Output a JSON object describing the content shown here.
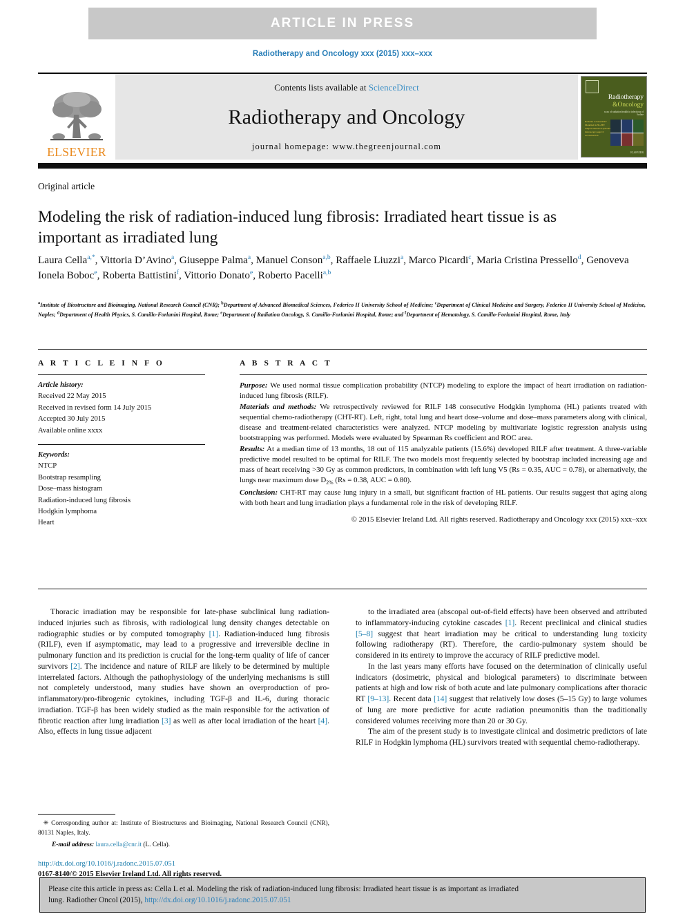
{
  "banner": {
    "text": "ARTICLE  IN  PRESS"
  },
  "running_head": "Radiotherapy and Oncology xxx (2015) xxx–xxx",
  "masthead": {
    "contents_prefix": "Contents lists available at ",
    "sciencedirect": "ScienceDirect",
    "journal_title": "Radiotherapy and Oncology",
    "homepage": "journal homepage: www.thegreenjournal.com",
    "publisher": "ELSEVIER",
    "cover": {
      "title_line1": "Radiotherapy",
      "title_line2": "&Oncology",
      "subtitle": "xxxx of radiation health in infectious of Isolate",
      "left_text": "Remarks to Issue RILF Modelled in HL-PET Subjects Research episodes microscopy page 10 reconstruction"
    }
  },
  "article_type": "Original article",
  "title": "Modeling the risk of radiation-induced lung fibrosis: Irradiated heart tissue is as important as irradiated lung",
  "authors": [
    {
      "name": "Laura Cella",
      "marks": "a,*"
    },
    {
      "name": "Vittoria D’Avino",
      "marks": "a"
    },
    {
      "name": "Giuseppe Palma",
      "marks": "a"
    },
    {
      "name": "Manuel Conson",
      "marks": "a,b"
    },
    {
      "name": "Raffaele Liuzzi",
      "marks": "a"
    },
    {
      "name": "Marco Picardi",
      "marks": "c"
    },
    {
      "name": "Maria Cristina Pressello",
      "marks": "d"
    },
    {
      "name": "Genoveva Ionela Boboc",
      "marks": "e"
    },
    {
      "name": "Roberta Battistini",
      "marks": "f"
    },
    {
      "name": "Vittorio Donato",
      "marks": "e"
    },
    {
      "name": "Roberto Pacelli",
      "marks": "a,b"
    }
  ],
  "affiliations": "Institute of Biostructure and Bioimaging, National Research Council (CNR); bDepartment of Advanced Biomedical Sciences, Federico II University School of Medicine; cDepartment of Clinical Medicine and Surgery, Federico II University School of Medicine, Naples; dDepartment of Health Physics, S. Camillo-Forlanini Hospital, Rome; eDepartment of Radiation Oncology, S. Camillo-Forlanini Hospital, Rome; and fDepartment of Hematology, S. Camillo-Forlanini Hospital, Rome, Italy",
  "article_info": {
    "heading": "A R T I C L E   I N F O",
    "history_label": "Article history:",
    "history": [
      "Received 22 May 2015",
      "Received in revised form 14 July 2015",
      "Accepted 30 July 2015",
      "Available online xxxx"
    ],
    "keywords_label": "Keywords:",
    "keywords": [
      "NTCP",
      "Bootstrap resampling",
      "Dose–mass histogram",
      "Radiation-induced lung fibrosis",
      "Hodgkin lymphoma",
      "Heart"
    ]
  },
  "abstract": {
    "heading": "A B S T R A C T",
    "purpose_label": "Purpose:",
    "purpose": " We used normal tissue complication probability (NTCP) modeling to explore the impact of heart irradiation on radiation-induced lung fibrosis (RILF).",
    "methods_label": "Materials and methods:",
    "methods": " We retrospectively reviewed for RILF 148 consecutive Hodgkin lymphoma (HL) patients treated with sequential chemo-radiotherapy (CHT-RT). Left, right, total lung and heart dose–volume and dose–mass parameters along with clinical, disease and treatment-related characteristics were analyzed. NTCP modeling by multivariate logistic regression analysis using bootstrapping was performed. Models were evaluated by Spearman Rs coefficient and ROC area.",
    "results_label": "Results:",
    "results": " At a median time of 13 months, 18 out of 115 analyzable patients (15.6%) developed RILF after treatment. A three-variable predictive model resulted to be optimal for RILF. The two models most frequently selected by bootstrap included increasing age and mass of heart receiving >30 Gy as common predictors, in combination with left lung V5 (Rs = 0.35, AUC = 0.78), or alternatively, the lungs near maximum dose D2% (Rs = 0.38, AUC = 0.80).",
    "conclusion_label": "Conclusion:",
    "conclusion": " CHT-RT may cause lung injury in a small, but significant fraction of HL patients. Our results suggest that aging along with both heart and lung irradiation plays a fundamental role in the risk of developing RILF.",
    "copyright": "© 2015 Elsevier Ireland Ltd. All rights reserved. Radiotherapy and Oncology xxx (2015) xxx–xxx"
  },
  "body": {
    "left_col": "Thoracic irradiation may be responsible for late-phase subclinical lung radiation-induced injuries such as fibrosis, with radiological lung density changes detectable on radiographic studies or by computed tomography [1]. Radiation-induced lung fibrosis (RILF), even if asymptomatic, may lead to a progressive and irreversible decline in pulmonary function and its prediction is crucial for the long-term quality of life of cancer survivors [2]. The incidence and nature of RILF are likely to be determined by multiple interrelated factors. Although the pathophysiology of the underlying mechanisms is still not completely understood, many studies have shown an overproduction of pro-inflammatory/pro-fibrogenic cytokines, including TGF-β and IL-6, during thoracic irradiation. TGF-β has been widely studied as the main responsible for the activation of fibrotic reaction after lung irradiation [3] as well as after local irradiation of the heart [4]. Also, effects in lung tissue adjacent",
    "right_col_p1": "to the irradiated area (abscopal out-of-field effects) have been observed and attributed to inflammatory-inducing cytokine cascades [1]. Recent preclinical and clinical studies [5–8] suggest that heart irradiation may be critical to understanding lung toxicity following radiotherapy (RT). Therefore, the cardio-pulmonary system should be considered in its entirety to improve the accuracy of RILF predictive model.",
    "right_col_p2": "In the last years many efforts have focused on the determination of clinically useful indicators (dosimetric, physical and biological parameters) to discriminate between patients at high and low risk of both acute and late pulmonary complications after thoracic RT [9–13]. Recent data [14] suggest that relatively low doses (5–15 Gy) to large volumes of lung are more predictive for acute radiation pneumonitis than the traditionally considered volumes receiving more than 20 or 30 Gy.",
    "right_col_p3": "The aim of the present study is to investigate clinical and dosimetric predictors of late RILF in Hodgkin lymphoma (HL) survivors treated with sequential chemo-radiotherapy."
  },
  "footnote": {
    "corresponding": "Corresponding author at: Institute of Biostructures and Bioimaging, National Research Council (CNR), 80131 Naples, Italy.",
    "email_label": "E-mail address:",
    "email": "laura.cella@cnr.it",
    "email_suffix": " (L. Cella)."
  },
  "doi_block": {
    "doi_url": "http://dx.doi.org/10.1016/j.radonc.2015.07.051",
    "issn_line": "0167-8140/© 2015 Elsevier Ireland Ltd. All rights reserved."
  },
  "cite_box": {
    "line1": "Please cite this article in press as: Cella L et al. Modeling the risk of radiation-induced lung fibrosis: Irradiated heart tissue is as important as irradiated",
    "line2_prefix": "lung. Radiother Oncol (2015), ",
    "line2_link": "http://dx.doi.org/10.1016/j.radonc.2015.07.051"
  },
  "colors": {
    "link": "#2a7fb8",
    "banner_bg": "#c8c8c8",
    "masthead_bg": "#e6e6e6",
    "elsevier_orange": "#ea8b20",
    "cover_green": "#4a5d1e"
  }
}
